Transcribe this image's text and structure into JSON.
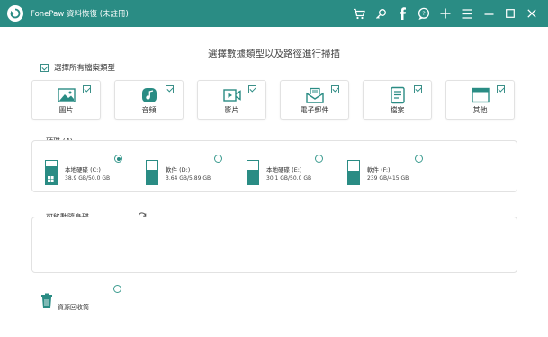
{
  "app": {
    "title": "FonePaw 資料恢復 (未註冊)"
  },
  "toolbar": {
    "icons": [
      "cart-icon",
      "key-icon",
      "facebook-icon",
      "chat-icon",
      "plus-icon",
      "menu-icon",
      "minimize-icon",
      "maximize-icon",
      "close-icon"
    ]
  },
  "main": {
    "heading": "選擇數據類型以及路徑進行掃描",
    "select_all_label": "選擇所有檔案類型",
    "select_all_checked": true,
    "file_types": [
      {
        "label": "圖片",
        "icon": "image-icon",
        "checked": true
      },
      {
        "label": "音頻",
        "icon": "audio-icon",
        "checked": true
      },
      {
        "label": "影片",
        "icon": "video-icon",
        "checked": true
      },
      {
        "label": "電子郵件",
        "icon": "email-icon",
        "checked": true
      },
      {
        "label": "檔案",
        "icon": "document-icon",
        "checked": true
      },
      {
        "label": "其他",
        "icon": "other-icon",
        "checked": true
      }
    ]
  },
  "drives": {
    "title": "硬碟 (4)",
    "items": [
      {
        "name": "本地硬碟 (C:)",
        "size": "38.9 GB/50.0 GB",
        "used_fraction": 0.78,
        "system": true,
        "selected": true
      },
      {
        "name": "軟件 (D:)",
        "size": "3.64 GB/5.89 GB",
        "used_fraction": 0.62,
        "system": false,
        "selected": false
      },
      {
        "name": "本地硬碟 (E:)",
        "size": "30.1 GB/50.0 GB",
        "used_fraction": 0.6,
        "system": false,
        "selected": false
      },
      {
        "name": "軟件 (F:)",
        "size": "239 GB/415 GB",
        "used_fraction": 0.58,
        "system": false,
        "selected": false
      }
    ]
  },
  "removable": {
    "title": "可移動隨身碟",
    "refresh_icon": "refresh-icon"
  },
  "recycle_bin": {
    "label": "資源回收筒",
    "icon": "trash-icon",
    "selected": false
  },
  "colors": {
    "accent": "#2a8c84",
    "border": "#e2e2e2"
  }
}
